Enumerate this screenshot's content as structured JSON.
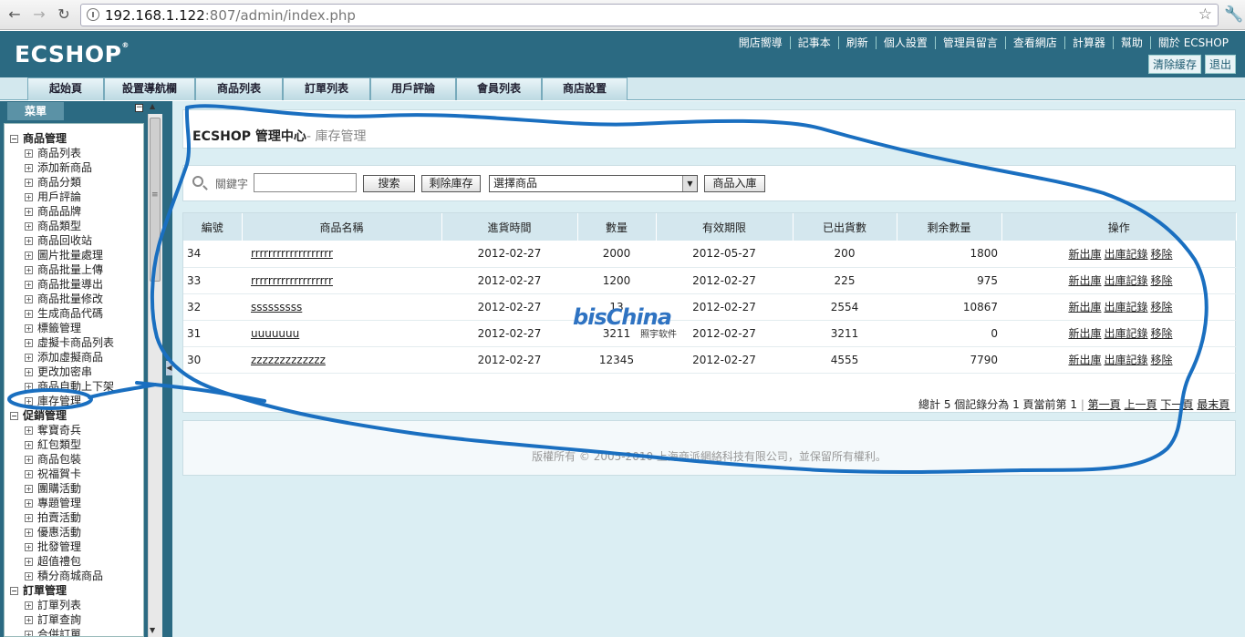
{
  "browser": {
    "url_host": "192.168.1.122",
    "url_path": ":807/admin/index.php"
  },
  "header": {
    "logo": "ECSHOP",
    "top_links": [
      "開店嚮導",
      "記事本",
      "刷新",
      "個人設置",
      "管理員留言",
      "查看網店",
      "計算器",
      "幫助",
      "關於 ECSHOP"
    ],
    "clear_cache": "清除緩存",
    "logout": "退出"
  },
  "tabs": [
    "起始頁",
    "設置導航欄",
    "商品列表",
    "訂單列表",
    "用戶評論",
    "會員列表",
    "商店設置"
  ],
  "sidebar": {
    "menu_label": "菜單",
    "groups": [
      {
        "label": "商品管理",
        "items": [
          "商品列表",
          "添加新商品",
          "商品分類",
          "用戶評論",
          "商品品牌",
          "商品類型",
          "商品回收站",
          "圖片批量處理",
          "商品批量上傳",
          "商品批量導出",
          "商品批量修改",
          "生成商品代碼",
          "標籤管理",
          "虛擬卡商品列表",
          "添加虛擬商品",
          "更改加密串",
          "商品自動上下架",
          "庫存管理"
        ]
      },
      {
        "label": "促銷管理",
        "items": [
          "奪寶奇兵",
          "紅包類型",
          "商品包裝",
          "祝福賀卡",
          "團購活動",
          "專題管理",
          "拍賣活動",
          "優惠活動",
          "批發管理",
          "超值禮包",
          "積分商城商品"
        ]
      },
      {
        "label": "訂單管理",
        "items": [
          "訂單列表",
          "訂單查詢",
          "合併訂單"
        ]
      }
    ]
  },
  "page": {
    "title": "ECSHOP 管理中心",
    "subtitle": "- 庫存管理"
  },
  "filter": {
    "keyword_label": "關鍵字",
    "keyword_value": "",
    "search_button": "搜索",
    "remove_stock_button": "剩除庫存",
    "goods_select_value": "選擇商品",
    "stock_in_button": "商品入庫"
  },
  "table": {
    "headers": [
      "編號",
      "商品名稱",
      "進貨時間",
      "數量",
      "有效期限",
      "已出貨數",
      "剩余數量",
      "操作"
    ],
    "rows": [
      {
        "id": "34",
        "name": "rrrrrrrrrrrrrrrrrrr",
        "date": "2012-02-27",
        "qty": "2000",
        "expiry": "2012-05-27",
        "shipped": "200",
        "remaining": "1800"
      },
      {
        "id": "33",
        "name": "rrrrrrrrrrrrrrrrrrr",
        "date": "2012-02-27",
        "qty": "1200",
        "expiry": "2012-02-27",
        "shipped": "225",
        "remaining": "975"
      },
      {
        "id": "32",
        "name": "sssssssss",
        "date": "2012-02-27",
        "qty": "13",
        "expiry": "2012-02-27",
        "shipped": "2554",
        "remaining": "10867"
      },
      {
        "id": "31",
        "name": "uuuuuuu",
        "date": "2012-02-27",
        "qty": "3211",
        "expiry": "2012-02-27",
        "shipped": "3211",
        "remaining": "0"
      },
      {
        "id": "30",
        "name": "zzzzzzzzzzzzz",
        "date": "2012-02-27",
        "qty": "12345",
        "expiry": "2012-02-27",
        "shipped": "4555",
        "remaining": "7790"
      }
    ],
    "actions": [
      "新出庫",
      "出庫記錄",
      "移除"
    ]
  },
  "pager": {
    "summary": "總計 5 個記錄分為 1 頁當前第 1",
    "first": "第一頁",
    "prev": "上一頁",
    "next": "下一頁",
    "last": "最末頁"
  },
  "footer": {
    "copyright": "版權所有 © 2005-2010 上海商派網絡科技有限公司，並保留所有權利。"
  },
  "watermark": {
    "main": "bisChina",
    "sub": "照宇软件"
  },
  "colors": {
    "header_bg": "#2b6a82",
    "main_bg": "#dbeef3",
    "table_header_bg": "#d4e7ee",
    "annotation_stroke": "#1a6fc0"
  }
}
